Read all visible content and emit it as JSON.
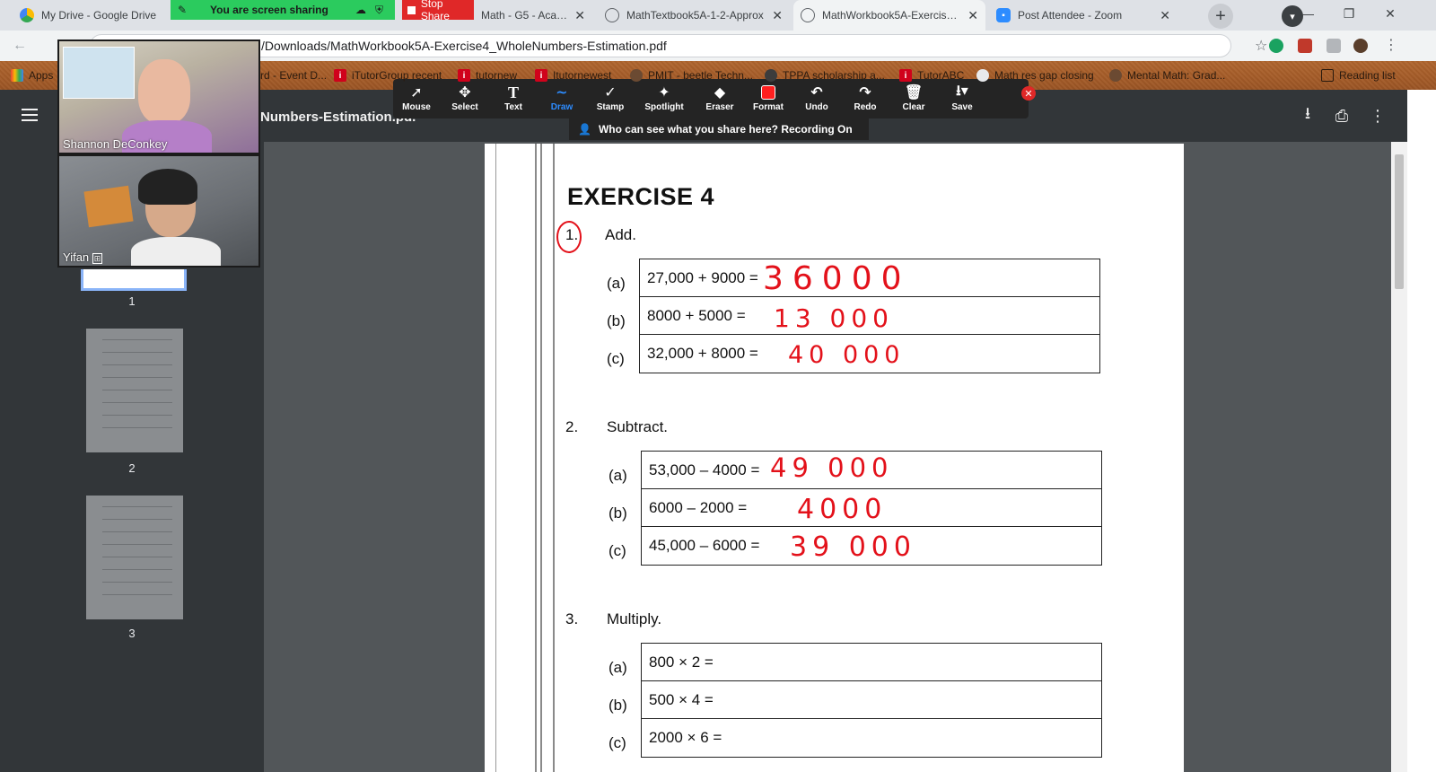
{
  "tabs": [
    {
      "label": "My Drive - Google Drive",
      "icon": "google-drive-icon",
      "active": false
    },
    {
      "label": "Math - G5 - Acade",
      "icon": "classroom-icon",
      "active": false
    },
    {
      "label": "MathTextbook5A-1-2-Approx",
      "icon": "globe-icon",
      "active": false
    },
    {
      "label": "MathWorkbook5A-Exercise4_",
      "icon": "globe-icon",
      "active": true
    },
    {
      "label": "Post Attendee - Zoom",
      "icon": "zoom-icon",
      "active": false
    }
  ],
  "share_banner": {
    "text": "You are screen sharing",
    "stop_label": "Stop Share"
  },
  "omnibox": {
    "url": "/Downloads/MathWorkbook5A-Exercise4_WholeNumbers-Estimation.pdf"
  },
  "bookmarks": [
    {
      "label": "Apps"
    },
    {
      "label": "rd - Event D..."
    },
    {
      "label": "iTutorGroup recent"
    },
    {
      "label": "tutornew"
    },
    {
      "label": "Itutornewest"
    },
    {
      "label": "PMIT - beetle Techn..."
    },
    {
      "label": "TPPA scholarship a..."
    },
    {
      "label": "TutorABC"
    },
    {
      "label": "Math res gap closing"
    },
    {
      "label": "Mental Math: Grad..."
    },
    {
      "label": "Reading list"
    }
  ],
  "pdf": {
    "title": "Numbers-Estimation.pd."
  },
  "annotate_tools": [
    {
      "label": "Mouse",
      "icon": "cursor-icon"
    },
    {
      "label": "Select",
      "icon": "move-icon"
    },
    {
      "label": "Text",
      "icon": "text-icon"
    },
    {
      "label": "Draw",
      "icon": "draw-icon",
      "active": true
    },
    {
      "label": "Stamp",
      "icon": "check-icon"
    },
    {
      "label": "Spotlight",
      "icon": "wand-icon"
    },
    {
      "label": "Eraser",
      "icon": "eraser-icon"
    },
    {
      "label": "Format",
      "icon": "color-swatch-icon"
    },
    {
      "label": "Undo",
      "icon": "undo-icon"
    },
    {
      "label": "Redo",
      "icon": "redo-icon"
    },
    {
      "label": "Clear",
      "icon": "trash-icon"
    },
    {
      "label": "Save",
      "icon": "save-icon"
    }
  ],
  "who_can_see": "Who can see what you share here? Recording On",
  "participants": [
    {
      "name": "Shannon DeConkey"
    },
    {
      "name": "Yifan"
    }
  ],
  "thumbnails": [
    "1",
    "2",
    "3"
  ],
  "exercise": {
    "title": "EXERCISE 4",
    "sections": [
      {
        "num": "1.",
        "instruction": "Add.",
        "items": [
          {
            "label": "(a)",
            "expr": "27,000 + 9000 =",
            "answer": "36000"
          },
          {
            "label": "(b)",
            "expr": "8000 + 5000 =",
            "answer": "13 000"
          },
          {
            "label": "(c)",
            "expr": "32,000 + 8000 =",
            "answer": "40 000"
          }
        ]
      },
      {
        "num": "2.",
        "instruction": "Subtract.",
        "items": [
          {
            "label": "(a)",
            "expr": "53,000 – 4000 =",
            "answer": "49 000"
          },
          {
            "label": "(b)",
            "expr": "6000 – 2000 =",
            "answer": "4000"
          },
          {
            "label": "(c)",
            "expr": "45,000 – 6000 =",
            "answer": "39 000"
          }
        ]
      },
      {
        "num": "3.",
        "instruction": "Multiply.",
        "items": [
          {
            "label": "(a)",
            "expr": "800 × 2 =",
            "answer": ""
          },
          {
            "label": "(b)",
            "expr": "500 × 4 =",
            "answer": ""
          },
          {
            "label": "(c)",
            "expr": "2000 × 6 =",
            "answer": ""
          }
        ]
      }
    ]
  },
  "colors": {
    "accent": "#2d8cff",
    "annotation": "#e3111a",
    "share_green": "#2bcb5e",
    "stop_red": "#e02828"
  }
}
